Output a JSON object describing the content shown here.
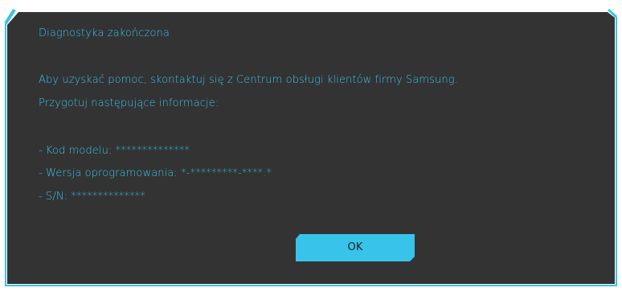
{
  "dialog": {
    "title": "Diagnostyka zakończona",
    "help_text": "Aby uzyskać pomoc, skontaktuj się z Centrum obsługi klientów firmy Samsung.",
    "prepare_text": "Przygotuj następujące informacje:",
    "model_code": "- Kod modelu: **************",
    "software_version": "- Wersja oprogramowania: *-*********-****.*",
    "serial_number": "- S/N: **************",
    "ok_label": "OK"
  },
  "colors": {
    "dialog_background": "#333333",
    "accent": "#38c4ea",
    "button_text": "#222222"
  }
}
